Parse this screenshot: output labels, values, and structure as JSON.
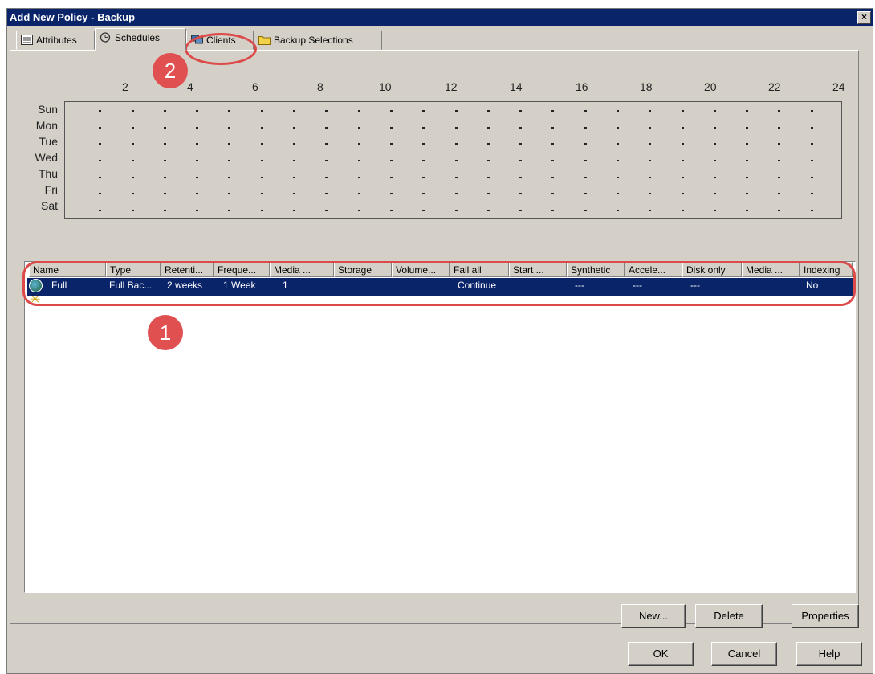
{
  "window": {
    "title": "Add New Policy - Backup",
    "close_label": "×"
  },
  "tabs": [
    {
      "label": "Attributes",
      "icon": "attributes-icon"
    },
    {
      "label": "Schedules",
      "icon": "schedules-icon",
      "active": true
    },
    {
      "label": "Clients",
      "icon": "clients-icon"
    },
    {
      "label": "Backup Selections",
      "icon": "backup-selections-icon"
    }
  ],
  "schedule_grid": {
    "hours": [
      "2",
      "4",
      "6",
      "8",
      "10",
      "12",
      "14",
      "16",
      "18",
      "20",
      "22",
      "24"
    ],
    "days": [
      "Sun",
      "Mon",
      "Tue",
      "Wed",
      "Thu",
      "Fri",
      "Sat"
    ]
  },
  "schedules_table": {
    "columns": [
      "Name",
      "Type",
      "Retenti...",
      "Freque...",
      "Media ...",
      "Storage",
      "Volume...",
      "Fail all",
      "Start ...",
      "Synthetic",
      "Accele...",
      "Disk only",
      "Media ...",
      "Indexing"
    ],
    "rows": [
      {
        "name": "Full",
        "type": "Full Bac...",
        "retention": "2 weeks",
        "frequency": "1 Week",
        "media": "1",
        "storage": "",
        "volume": "",
        "fail_all": "Continue",
        "start": "",
        "synthetic": "---",
        "accelerator": "---",
        "disk_only": "---",
        "media2": "",
        "indexing": "No",
        "selected": true
      }
    ]
  },
  "annotations": {
    "badge_1": "1",
    "badge_2": "2",
    "color": "#dc4a4a"
  },
  "buttons": {
    "new": "New...",
    "delete": "Delete",
    "properties": "Properties",
    "ok": "OK",
    "cancel": "Cancel",
    "help": "Help"
  },
  "colors": {
    "titlebar": "#0a246a",
    "dialog": "#d4d0c8",
    "selection": "#0a246a"
  }
}
